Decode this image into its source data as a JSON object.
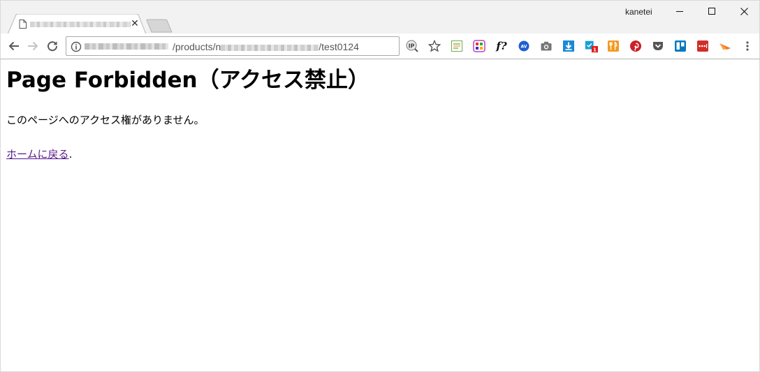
{
  "window": {
    "profile_name": "kanetei",
    "minimize_icon": "minimize-icon",
    "maximize_icon": "maximize-icon",
    "close_icon": "close-icon"
  },
  "tab": {
    "title": "",
    "close_label": "✕"
  },
  "toolbar": {
    "back_icon": "arrow-left-icon",
    "forward_icon": "arrow-right-icon",
    "reload_icon": "reload-icon",
    "url_path_before": "/products/",
    "url_path_initial": "n",
    "url_path_after": "/test0124",
    "bookmark_icon": "star-icon"
  },
  "extensions": [
    "ip-lookup-icon",
    "star-icon",
    "rss-icon",
    "colorful-grid-icon",
    "formula-icon",
    "av-icon",
    "camera-icon",
    "download-icon",
    "checkbox-icon",
    "fork-knife-icon",
    "pinterest-icon",
    "pocket-icon",
    "trello-icon",
    "lastpass-icon",
    "orange-slice-icon",
    "menu-icon"
  ],
  "extension_badge": "1",
  "colors": {
    "link_visited": "#551a8b",
    "pinterest": "#cb2027",
    "pocket": "#555555",
    "trello": "#0079bf",
    "download": "#1a8ad4",
    "lastpass": "#d32d27",
    "orange": "#f07c1e"
  },
  "page": {
    "title": "Page Forbidden（アクセス禁止）",
    "message": "このページへのアクセス権がありません。",
    "home_link": "ホームに戻る",
    "home_suffix": "."
  }
}
